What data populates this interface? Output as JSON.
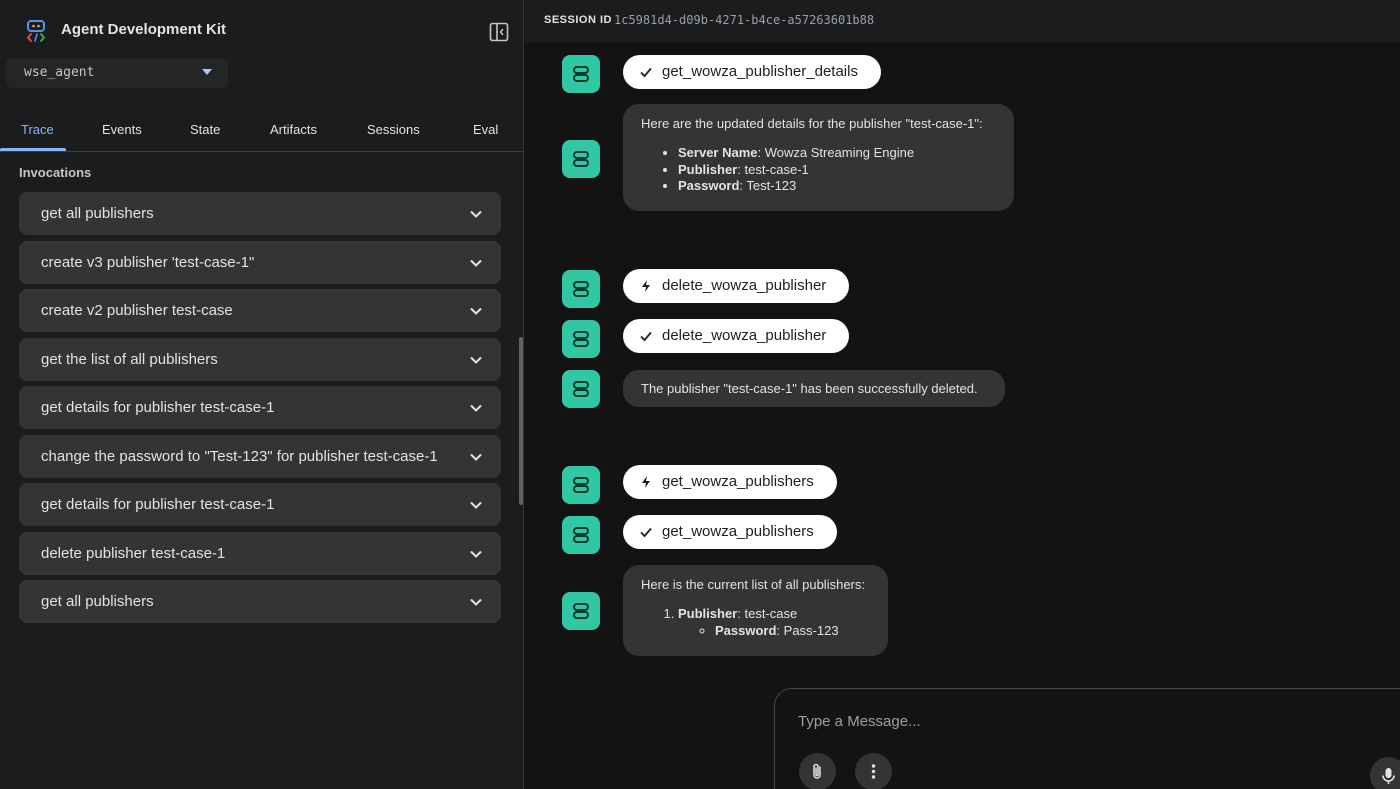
{
  "app": {
    "title": "Agent Development Kit"
  },
  "agent_selector": {
    "value": "wse_agent"
  },
  "tabs": [
    {
      "label": "Trace",
      "active": true
    },
    {
      "label": "Events",
      "active": false
    },
    {
      "label": "State",
      "active": false
    },
    {
      "label": "Artifacts",
      "active": false
    },
    {
      "label": "Sessions",
      "active": false
    },
    {
      "label": "Eval",
      "active": false
    }
  ],
  "invocations": {
    "heading": "Invocations",
    "items": [
      "get all publishers",
      "create v3 publisher 'test-case-1\"",
      "create v2 publisher test-case",
      "get the list of all publishers",
      "get details for publisher test-case-1",
      "change the password to \"Test-123\" for publisher test-case-1",
      "get details for publisher test-case-1",
      "delete publisher test-case-1",
      "get all publishers"
    ]
  },
  "session": {
    "label": "SESSION ID",
    "id": "1c5981d4-d09b-4271-b4ce-a57263601b88"
  },
  "messages": {
    "m1": {
      "icon": "check-icon",
      "text": "get_wowza_publisher_details"
    },
    "m2": {
      "intro": "Here are the updated details for the publisher \"test-case-1\":",
      "items": [
        {
          "key": "Server Name",
          "value": ": Wowza Streaming Engine"
        },
        {
          "key": "Publisher",
          "value": ": test-case-1"
        },
        {
          "key": "Password",
          "value": ": Test-123"
        }
      ]
    },
    "m3": {
      "icon": "bolt-icon",
      "text": "delete_wowza_publisher"
    },
    "m4": {
      "icon": "check-icon",
      "text": "delete_wowza_publisher"
    },
    "m5": {
      "text": "The publisher \"test-case-1\" has been successfully deleted."
    },
    "m6": {
      "icon": "bolt-icon",
      "text": "get_wowza_publishers"
    },
    "m7": {
      "icon": "check-icon",
      "text": "get_wowza_publishers"
    },
    "m8": {
      "intro": "Here is the current list of all publishers:",
      "item_key": "Publisher",
      "item_value": ": test-case",
      "sub_key": "Password",
      "sub_value": ": Pass-123"
    }
  },
  "composer": {
    "placeholder": "Type a Message..."
  },
  "colors": {
    "accent": "#8ab4f8",
    "avatar": "#31c7a4",
    "bubble": "#333435",
    "chip": "#ffffff"
  }
}
